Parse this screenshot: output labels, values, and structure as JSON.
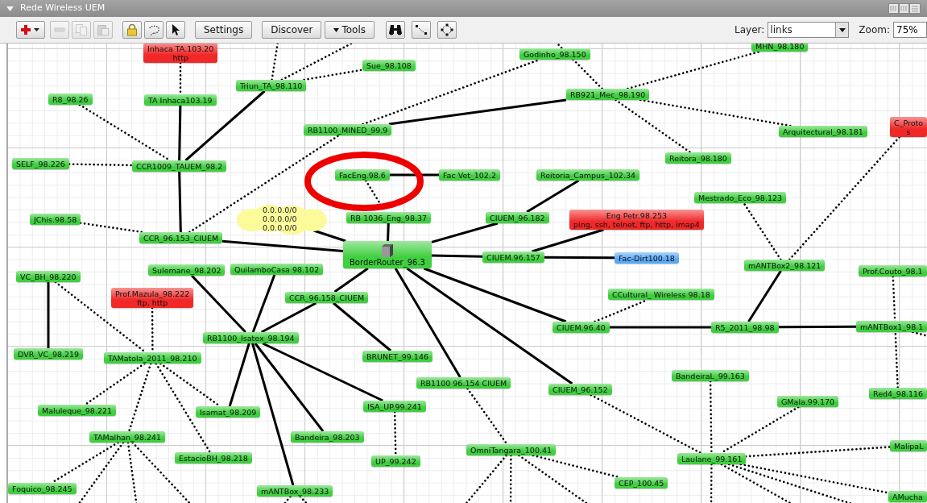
{
  "window": {
    "title": "Rede Wireless UEM"
  },
  "toolbar": {
    "items": [
      {
        "kind": "icon",
        "disabled": false
      },
      {
        "kind": "icon",
        "disabled": true
      },
      {
        "kind": "icon",
        "disabled": true
      },
      {
        "kind": "icon",
        "disabled": true
      },
      {
        "kind": "icon",
        "disabled": false
      },
      {
        "kind": "icon",
        "disabled": false
      },
      {
        "kind": "icon",
        "disabled": false
      },
      {
        "kind": "text",
        "label": "Settings"
      },
      {
        "kind": "text",
        "label": "Discover"
      },
      {
        "kind": "menu",
        "label": "Tools"
      },
      {
        "kind": "icon",
        "disabled": false
      },
      {
        "kind": "icon",
        "disabled": false
      },
      {
        "kind": "icon",
        "disabled": false
      }
    ],
    "layer": {
      "label": "Layer:",
      "value": "links"
    },
    "zoom": {
      "label": "Zoom:",
      "value": "75%"
    }
  },
  "nodes": [
    {
      "kind": "device",
      "label": "Inhaca TA.103.20",
      "services": "http",
      "color": "#f02828"
    },
    {
      "kind": "device",
      "label": "Sue_98.108",
      "color": "#3fcf3f"
    },
    {
      "kind": "device",
      "label": "Godinho_98.150",
      "color": "#3fcf3f"
    },
    {
      "kind": "device",
      "label": "MHN_98.180",
      "color": "#3fcf3f"
    },
    {
      "kind": "device",
      "label": "Triun_TA_98.110",
      "color": "#3fcf3f"
    },
    {
      "kind": "device",
      "label": "R8_98.26",
      "color": "#3fcf3f"
    },
    {
      "kind": "device",
      "label": "TA Inhaca103.19",
      "color": "#3fcf3f"
    },
    {
      "kind": "device",
      "label": "RB921_Mec_98.190",
      "color": "#3fcf3f"
    },
    {
      "kind": "device",
      "label": "RB1100_MINED_99.9",
      "color": "#3fcf3f"
    },
    {
      "kind": "device",
      "label": "Arquitectural_98.181",
      "color": "#3fcf3f"
    },
    {
      "kind": "device",
      "label": "C_Proto",
      "services": "s",
      "color": "#f02828"
    },
    {
      "kind": "device",
      "label": "Reitora_98.180",
      "color": "#3fcf3f"
    },
    {
      "kind": "device",
      "label": "SELF_98.226",
      "color": "#3fcf3f"
    },
    {
      "kind": "device",
      "label": "CCR1009_TAUEM_98.2",
      "color": "#3fcf3f"
    },
    {
      "kind": "device",
      "label": "FacEng.98.6",
      "color": "#3fcf3f"
    },
    {
      "kind": "device",
      "label": "Fac Vet_102.2",
      "color": "#3fcf3f"
    },
    {
      "kind": "device",
      "label": "Reitoria_Campus_102.34",
      "color": "#3fcf3f"
    },
    {
      "kind": "device",
      "label": "Mestrado_Eco_98.123",
      "color": "#3fcf3f"
    },
    {
      "kind": "device",
      "label": "JChis.98.58",
      "color": "#3fcf3f"
    },
    {
      "kind": "cloud",
      "routes": [
        "0.0.0.0/0",
        "0.0.0.0/0",
        "0.0.0.0/0"
      ]
    },
    {
      "kind": "device",
      "label": "RB 1036_Eng_98.37",
      "color": "#3fcf3f"
    },
    {
      "kind": "device",
      "label": "CIUEM_96.182",
      "color": "#3fcf3f"
    },
    {
      "kind": "device",
      "label": "Eng Petr.98.253",
      "services": "ping, ssh, telnet, ftp, http, imap4",
      "color": "#f02828"
    },
    {
      "kind": "device",
      "label": "CCR_96.153_CIUEM",
      "color": "#3fcf3f"
    },
    {
      "kind": "device",
      "label": "Sulemane_98.202",
      "color": "#3fcf3f"
    },
    {
      "kind": "device",
      "label": "QuilamboCasa 98.102",
      "color": "#3fcf3f"
    },
    {
      "kind": "router",
      "label": "BorderRouter_96.3",
      "color": "#3fcf3f"
    },
    {
      "kind": "device",
      "label": "CIUEM.96.157",
      "color": "#3fcf3f"
    },
    {
      "kind": "device",
      "label": "Fac-Dirt100.18",
      "color": "#5aa8f5"
    },
    {
      "kind": "device",
      "label": "mANTBox2_98.121",
      "color": "#3fcf3f"
    },
    {
      "kind": "device",
      "label": "Prof.Couto_98.1",
      "color": "#3fcf3f"
    },
    {
      "kind": "device",
      "label": "VC_BH_98.220",
      "color": "#3fcf3f"
    },
    {
      "kind": "device",
      "label": "Prof.Mazula_98.222",
      "services": "ftp, http",
      "color": "#f02828"
    },
    {
      "kind": "device",
      "label": "CCR_96.158_CIUEM",
      "color": "#3fcf3f"
    },
    {
      "kind": "device",
      "label": "CCultural_ Wireless 98.18",
      "color": "#3fcf3f"
    },
    {
      "kind": "device",
      "label": "CIUEM.96.40",
      "color": "#3fcf3f"
    },
    {
      "kind": "device",
      "label": "R5_2011_98.98",
      "color": "#3fcf3f"
    },
    {
      "kind": "device",
      "label": "mANTBox1_98.1",
      "color": "#3fcf3f"
    },
    {
      "kind": "device",
      "label": "RB1100_Isatex_98.194",
      "color": "#3fcf3f"
    },
    {
      "kind": "device",
      "label": "DVR_VC_98.219",
      "color": "#3fcf3f"
    },
    {
      "kind": "device",
      "label": "TAMatola_2011_98.210",
      "color": "#3fcf3f"
    },
    {
      "kind": "device",
      "label": "BRUNET_99.146",
      "color": "#3fcf3f"
    },
    {
      "kind": "device",
      "label": "RB1100 96.154 CIUEM",
      "color": "#3fcf3f"
    },
    {
      "kind": "device",
      "label": "CIUEM_96.152",
      "color": "#3fcf3f"
    },
    {
      "kind": "device",
      "label": "BandeiraL_99.163",
      "color": "#3fcf3f"
    },
    {
      "kind": "device",
      "label": "GMala.99.170",
      "color": "#3fcf3f"
    },
    {
      "kind": "device",
      "label": "Red4_98.116",
      "color": "#3fcf3f"
    },
    {
      "kind": "device",
      "label": "Maluleque_98.221",
      "color": "#3fcf3f"
    },
    {
      "kind": "device",
      "label": "Isamat_98.209",
      "color": "#3fcf3f"
    },
    {
      "kind": "device",
      "label": "ISA_UP.99.241",
      "color": "#3fcf3f"
    },
    {
      "kind": "device",
      "label": "TAMalhan_98.241",
      "color": "#3fcf3f"
    },
    {
      "kind": "device",
      "label": "Bandeira_98.203",
      "color": "#3fcf3f"
    },
    {
      "kind": "device",
      "label": "EstacioBH_98.218",
      "color": "#3fcf3f"
    },
    {
      "kind": "device",
      "label": "UP_99.242",
      "color": "#3fcf3f"
    },
    {
      "kind": "device",
      "label": "OmniTangara_100.41",
      "color": "#3fcf3f"
    },
    {
      "kind": "device",
      "label": "Laulane_99.161",
      "color": "#3fcf3f"
    },
    {
      "kind": "device",
      "label": "MalipaL",
      "color": "#3fcf3f"
    },
    {
      "kind": "device",
      "label": "CEP_100.45",
      "color": "#3fcf3f"
    },
    {
      "kind": "device",
      "label": "Foquico_98.245",
      "color": "#3fcf3f"
    },
    {
      "kind": "device",
      "label": "mANTBox_98.233",
      "color": "#3fcf3f"
    },
    {
      "kind": "device",
      "label": "AMucha",
      "color": "#3fcf3f"
    }
  ],
  "links": [
    {
      "kind": "wired"
    },
    {
      "kind": "wired"
    },
    {
      "kind": "wired"
    },
    {
      "kind": "wired"
    },
    {
      "kind": "wired"
    },
    {
      "kind": "wired"
    },
    {
      "kind": "wired"
    },
    {
      "kind": "wired"
    },
    {
      "kind": "wired"
    },
    {
      "kind": "wired"
    },
    {
      "kind": "wired"
    },
    {
      "kind": "wired"
    },
    {
      "kind": "wired"
    },
    {
      "kind": "wired"
    },
    {
      "kind": "wired"
    },
    {
      "kind": "wired"
    },
    {
      "kind": "wired"
    },
    {
      "kind": "wired"
    },
    {
      "kind": "wired"
    },
    {
      "kind": "wired"
    },
    {
      "kind": "wired"
    },
    {
      "kind": "wired"
    },
    {
      "kind": "wired"
    },
    {
      "kind": "wired"
    },
    {
      "kind": "wired"
    },
    {
      "kind": "wired"
    },
    {
      "kind": "wired"
    },
    {
      "kind": "wired"
    },
    {
      "kind": "wired"
    },
    {
      "kind": "wireless"
    },
    {
      "kind": "wireless"
    },
    {
      "kind": "wireless"
    },
    {
      "kind": "wireless"
    },
    {
      "kind": "wireless"
    },
    {
      "kind": "wireless"
    },
    {
      "kind": "wireless"
    },
    {
      "kind": "wireless"
    },
    {
      "kind": "wireless"
    },
    {
      "kind": "wireless"
    },
    {
      "kind": "wireless"
    },
    {
      "kind": "wireless"
    },
    {
      "kind": "wireless"
    },
    {
      "kind": "wireless"
    },
    {
      "kind": "wireless"
    },
    {
      "kind": "wireless"
    },
    {
      "kind": "wireless"
    },
    {
      "kind": "wireless"
    },
    {
      "kind": "wireless"
    },
    {
      "kind": "wireless"
    },
    {
      "kind": "wireless"
    },
    {
      "kind": "wireless"
    },
    {
      "kind": "wireless"
    },
    {
      "kind": "wireless"
    },
    {
      "kind": "wireless"
    },
    {
      "kind": "wireless"
    },
    {
      "kind": "wireless"
    },
    {
      "kind": "wireless"
    },
    {
      "kind": "wireless"
    },
    {
      "kind": "wireless"
    },
    {
      "kind": "wireless"
    },
    {
      "kind": "wireless"
    },
    {
      "kind": "wireless"
    },
    {
      "kind": "wireless"
    },
    {
      "kind": "wireless"
    },
    {
      "kind": "wireless"
    },
    {
      "kind": "wireless"
    },
    {
      "kind": "wireless"
    },
    {
      "kind": "wireless"
    },
    {
      "kind": "wireless"
    },
    {
      "kind": "wireless"
    },
    {
      "kind": "wireless"
    },
    {
      "kind": "wireless"
    },
    {
      "kind": "wireless"
    },
    {
      "kind": "wireless"
    }
  ],
  "annotations": [
    {
      "kind": "ellipse"
    }
  ]
}
